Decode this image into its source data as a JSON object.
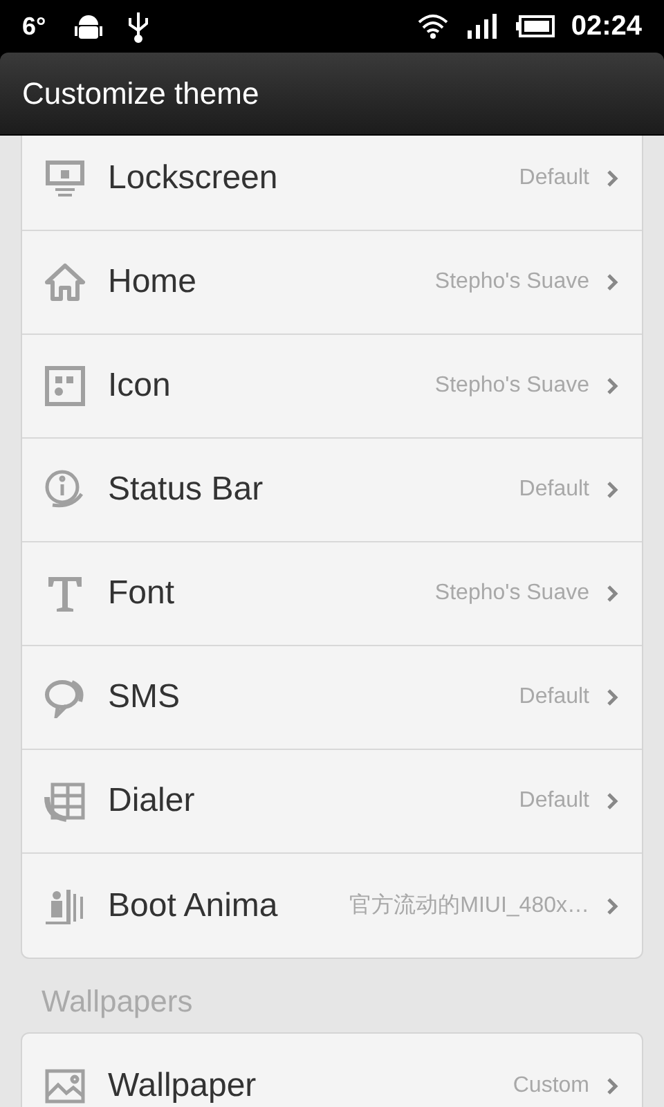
{
  "status_bar": {
    "temperature": "6°",
    "time": "02:24"
  },
  "title": "Customize theme",
  "theme_items": [
    {
      "label": "Lockscreen",
      "value": "Default"
    },
    {
      "label": "Home",
      "value": "Stepho's Suave"
    },
    {
      "label": "Icon",
      "value": "Stepho's Suave"
    },
    {
      "label": "Status Bar",
      "value": "Default"
    },
    {
      "label": "Font",
      "value": "Stepho's Suave"
    },
    {
      "label": "SMS",
      "value": "Default"
    },
    {
      "label": "Dialer",
      "value": "Default"
    },
    {
      "label": "Boot Anima",
      "value": "官方流动的MIUI_480x…"
    }
  ],
  "wallpapers": {
    "heading": "Wallpapers",
    "items": [
      {
        "label": "Wallpaper",
        "value": "Custom"
      }
    ]
  }
}
